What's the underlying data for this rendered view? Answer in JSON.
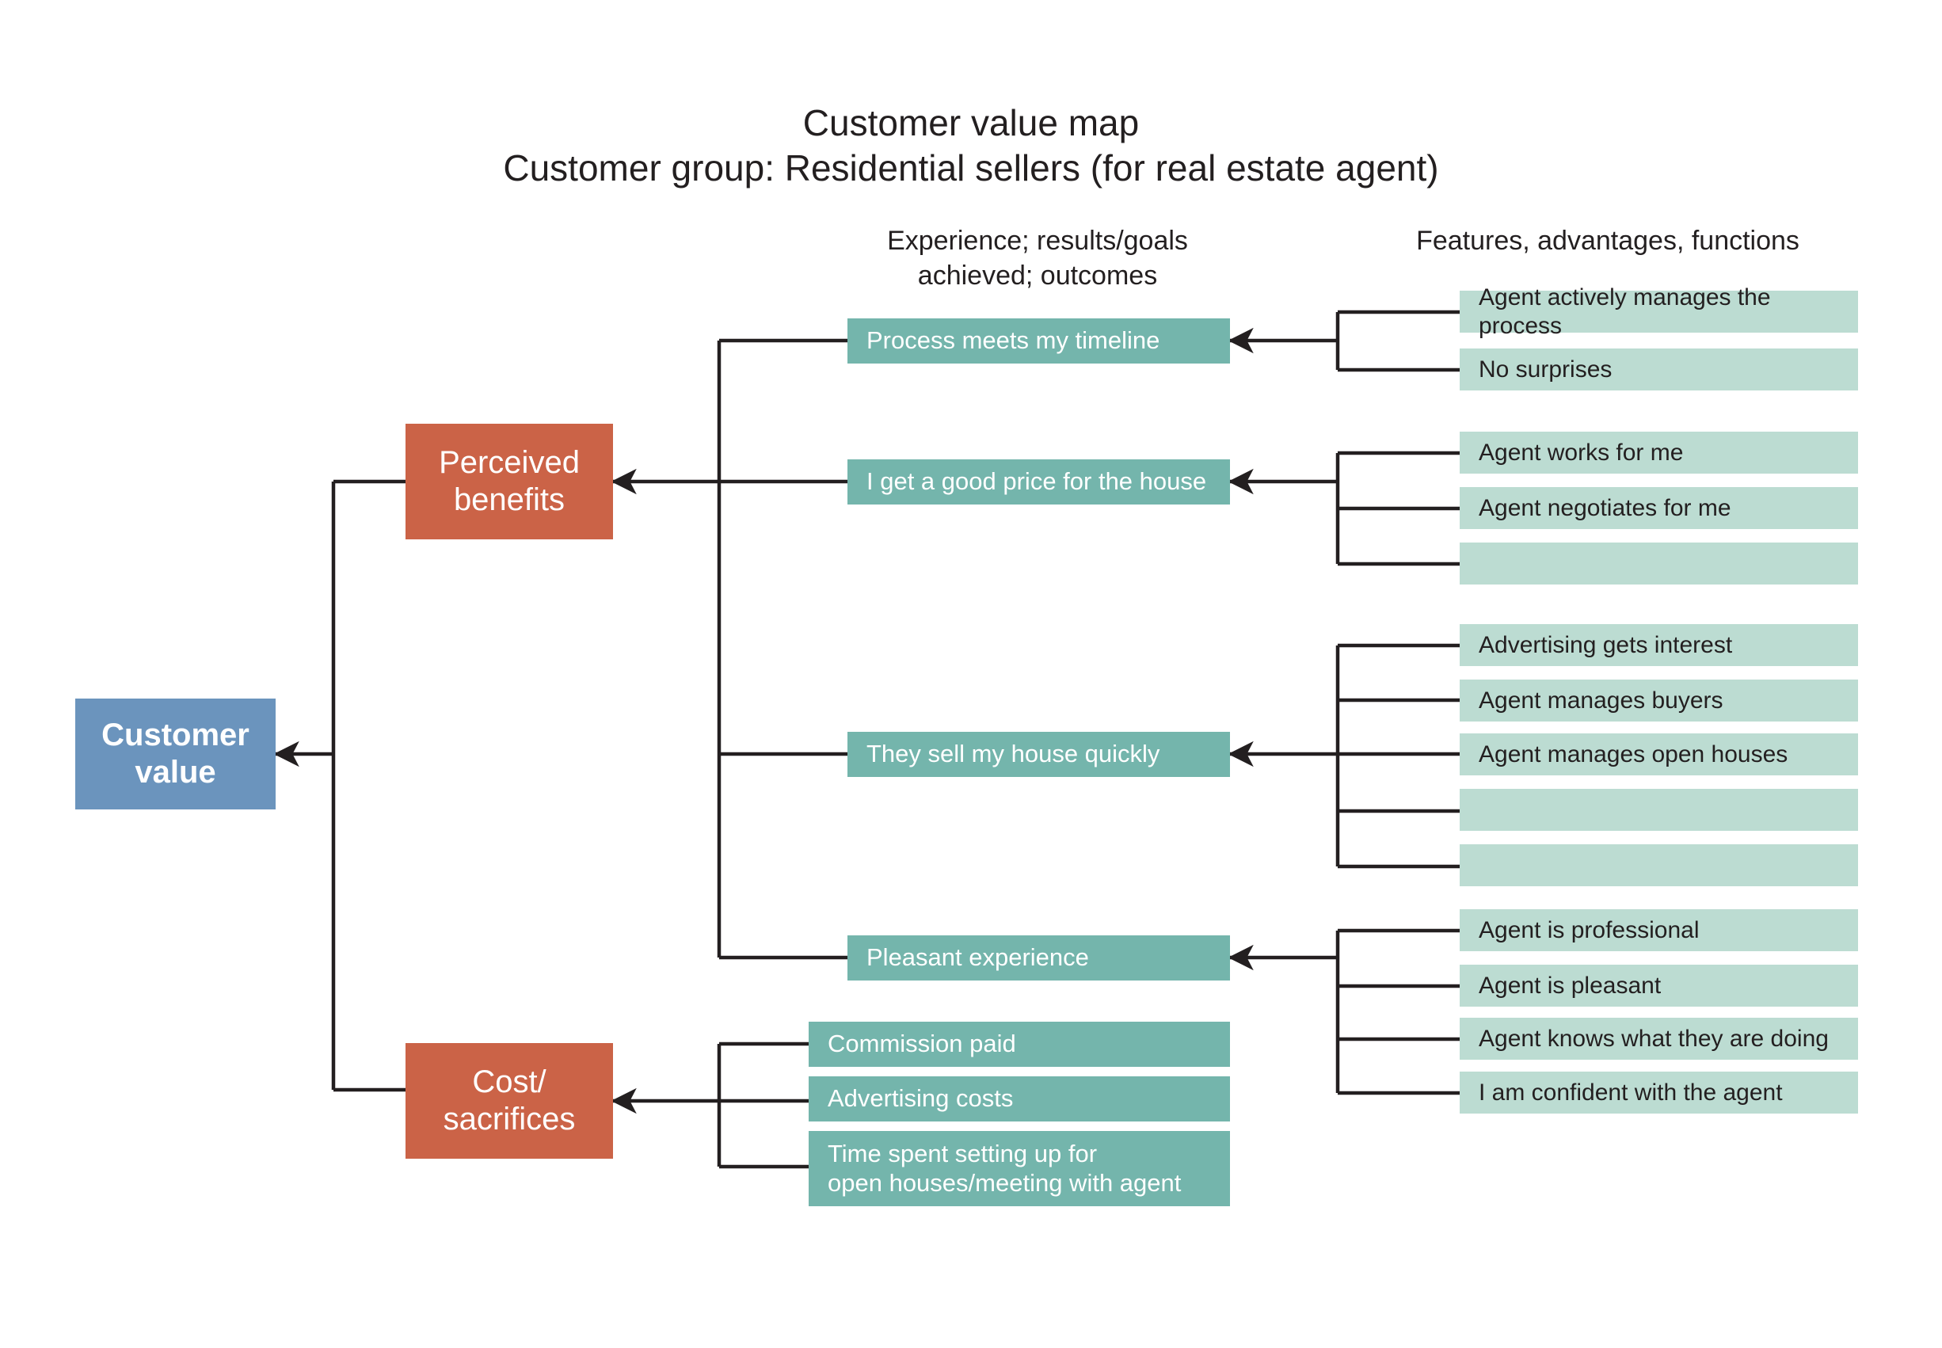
{
  "diagram": {
    "title": "Customer value map",
    "subtitle": "Customer group: Residential sellers (for real estate agent)",
    "column_headers": {
      "middle": "Experience; results/goals\nachieved; outcomes",
      "middle_line1": "Experience; results/goals",
      "middle_line2": "achieved; outcomes",
      "right": "Features, advantages, functions"
    },
    "colors": {
      "root": "#6b94bd",
      "category": "#cb6347",
      "outcome": "#74b5ac",
      "feature": "#bcdcd2",
      "connector": "#231f20",
      "background": "#ffffff",
      "text_dark": "#231f20",
      "text_light": "#ffffff"
    },
    "root": {
      "label_line1": "Customer",
      "label_line2": "value"
    },
    "categories": [
      {
        "id": "perceived-benefits",
        "label_line1": "Perceived",
        "label_line2": "benefits"
      },
      {
        "id": "cost-sacrifices",
        "label_line1": "Cost/",
        "label_line2": "sacrifices"
      }
    ],
    "outcomes": [
      {
        "id": "process-timeline",
        "label": "Process meets my timeline",
        "parent": "perceived-benefits"
      },
      {
        "id": "good-price",
        "label": "I get a good price for the house",
        "parent": "perceived-benefits"
      },
      {
        "id": "sell-quickly",
        "label": "They sell my house quickly",
        "parent": "perceived-benefits"
      },
      {
        "id": "pleasant",
        "label": "Pleasant experience",
        "parent": "perceived-benefits"
      },
      {
        "id": "commission",
        "label": "Commission paid",
        "parent": "cost-sacrifices"
      },
      {
        "id": "advertising-costs",
        "label": "Advertising costs",
        "parent": "cost-sacrifices"
      },
      {
        "id": "time-spent-l1",
        "label": "Time spent setting up for",
        "parent": "cost-sacrifices"
      },
      {
        "id": "time-spent-l2",
        "label": "open houses/meeting with agent",
        "parent": "cost-sacrifices"
      }
    ],
    "feature_groups": [
      {
        "id": "group-process-timeline",
        "parent": "process-timeline",
        "items": [
          "Agent actively manages the process",
          "No surprises"
        ]
      },
      {
        "id": "group-good-price",
        "parent": "good-price",
        "items": [
          "Agent works for me",
          "Agent negotiates for me",
          ""
        ]
      },
      {
        "id": "group-sell-quickly",
        "parent": "sell-quickly",
        "items": [
          "Advertising gets interest",
          "Agent manages buyers",
          "Agent manages open houses",
          "",
          ""
        ]
      },
      {
        "id": "group-pleasant",
        "parent": "pleasant",
        "items": [
          "Agent is professional",
          "Agent is pleasant",
          "Agent knows what they are doing",
          "I am confident with the agent"
        ]
      }
    ]
  }
}
